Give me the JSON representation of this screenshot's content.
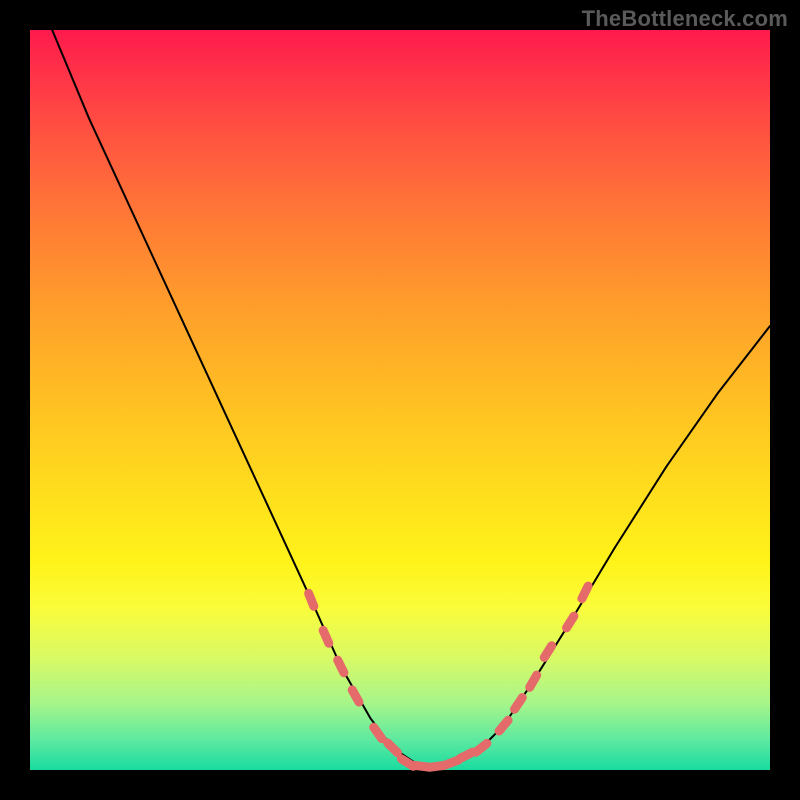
{
  "watermark": "TheBottleneck.com",
  "colors": {
    "background": "#000000",
    "curve_stroke": "#000000",
    "marker_fill": "#e56a6a",
    "gradient_top": "#ff1a4d",
    "gradient_bottom": "#19dba0"
  },
  "chart_data": {
    "type": "line",
    "title": "",
    "xlabel": "",
    "ylabel": "",
    "xlim": [
      0,
      100
    ],
    "ylim": [
      0,
      100
    ],
    "series": [
      {
        "name": "bottleneck-curve",
        "x": [
          3,
          8,
          14,
          20,
          26,
          32,
          38,
          42,
          46,
          49,
          52,
          55,
          58,
          61,
          64,
          68,
          73,
          79,
          86,
          93,
          100
        ],
        "y": [
          100,
          88,
          75,
          62,
          49,
          36,
          23,
          14,
          7,
          3,
          1,
          0.5,
          1,
          3,
          6,
          12,
          20,
          30,
          41,
          51,
          60
        ]
      }
    ],
    "markers": {
      "name": "highlight-dots",
      "x": [
        38,
        40,
        42,
        44,
        47,
        49,
        51,
        53,
        55,
        57,
        59,
        61,
        64,
        66,
        68,
        70,
        73,
        75
      ],
      "y": [
        23,
        18,
        14,
        10,
        5,
        3,
        1,
        0.5,
        0.5,
        1,
        2,
        3,
        6,
        9,
        12,
        16,
        20,
        24
      ]
    }
  }
}
